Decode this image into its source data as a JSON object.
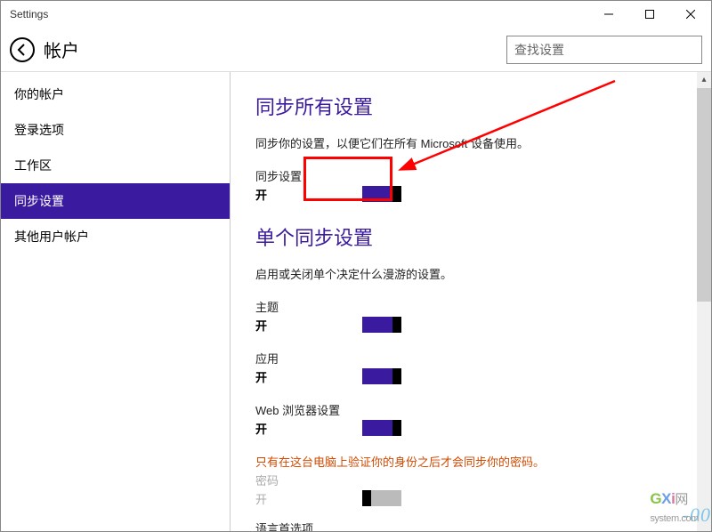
{
  "window": {
    "title": "Settings"
  },
  "header": {
    "title": "帐户",
    "search_placeholder": "查找设置"
  },
  "sidebar": {
    "items": [
      {
        "label": "你的帐户"
      },
      {
        "label": "登录选项"
      },
      {
        "label": "工作区"
      },
      {
        "label": "同步设置"
      },
      {
        "label": "其他用户帐户"
      }
    ],
    "selected_index": 3
  },
  "content": {
    "section_sync_all": {
      "title": "同步所有设置",
      "description": "同步你的设置，以便它们在所有 Microsoft 设备使用。",
      "toggle": {
        "label": "同步设置",
        "state_text": "开",
        "on": true
      }
    },
    "section_individual": {
      "title": "单个同步设置",
      "description": "启用或关闭单个决定什么漫游的设置。",
      "items": [
        {
          "label": "主题",
          "state_text": "开",
          "on": true
        },
        {
          "label": "应用",
          "state_text": "开",
          "on": true
        },
        {
          "label": "Web 浏览器设置",
          "state_text": "开",
          "on": true
        }
      ],
      "warning": "只有在这台电脑上验证你的身份之后才会同步你的密码。",
      "disabled_item": {
        "label": "密码",
        "state_text": "开",
        "on": false
      },
      "trailing_label": "语言首选项"
    }
  },
  "watermark": {
    "g": "G",
    "x": "X",
    "i": "i",
    "rest": "网",
    "domain": "system.com"
  }
}
